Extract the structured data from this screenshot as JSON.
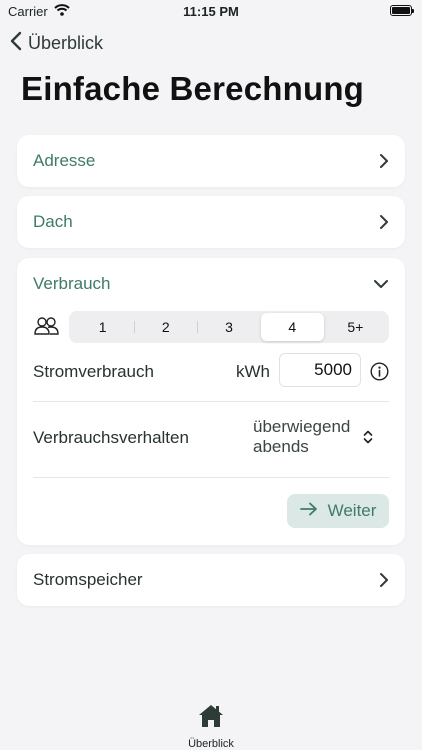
{
  "status": {
    "carrier": "Carrier",
    "time": "11:15 PM"
  },
  "nav": {
    "back_label": "Überblick"
  },
  "page": {
    "title": "Einfache Berechnung"
  },
  "sections": {
    "adresse": "Adresse",
    "dach": "Dach",
    "verbrauch": "Verbrauch",
    "stromspeicher": "Stromspeicher"
  },
  "verbrauch": {
    "household_options": [
      "1",
      "2",
      "3",
      "4",
      "5+"
    ],
    "selected_household": "4",
    "stromverbrauch_label": "Stromverbrauch",
    "unit": "kWh",
    "stromverbrauch_value": "5000",
    "verhalten_label": "Verbrauchsverhalten",
    "verhalten_value_line1": "überwiegend",
    "verhalten_value_line2": "abends",
    "weiter_label": "Weiter"
  },
  "tabbar": {
    "overview_label": "Überblick"
  },
  "colors": {
    "accent": "#3f7a6b",
    "button_bg": "#dbe8e5",
    "background": "#f4f4f6"
  }
}
